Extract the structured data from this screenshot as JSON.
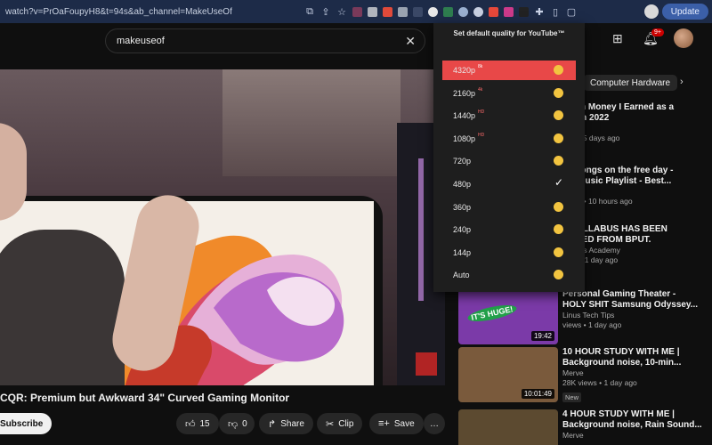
{
  "browser": {
    "url": "watch?v=PrOaFoupyH8&t=94s&ab_channel=MakeUseOf",
    "update_label": "Update"
  },
  "header": {
    "search_value": "makeuseof",
    "notifications_badge": "9+"
  },
  "popup": {
    "title": "Set default quality for YouTube™",
    "options": [
      {
        "label": "4320p",
        "tag": "8k",
        "selected": true
      },
      {
        "label": "2160p",
        "tag": "4k"
      },
      {
        "label": "1440p",
        "tag": "HD"
      },
      {
        "label": "1080p",
        "tag": "HD"
      },
      {
        "label": "720p",
        "tag": ""
      },
      {
        "label": "480p",
        "tag": "",
        "checked": true
      },
      {
        "label": "360p",
        "tag": ""
      },
      {
        "label": "240p",
        "tag": ""
      },
      {
        "label": "144p",
        "tag": ""
      },
      {
        "label": "Auto",
        "tag": ""
      }
    ]
  },
  "video": {
    "title": "CQR: Premium but Awkward 34\" Curved Gaming Monitor",
    "subscribe_label": "Subscribe",
    "like_count": "15",
    "dislike_count": "0",
    "share_label": "Share",
    "clip_label": "Clip",
    "save_label": "Save",
    "more_label": "…"
  },
  "sidebar": {
    "chip_label": "Computer Hardware",
    "recommendations": [
      {
        "title_1": "Much Money I Earned as a",
        "title_2": "ber in 2022",
        "meta_1": "sel",
        "meta_2": "ews • 5 days ago",
        "duration": "",
        "thumb": "#3a2f44"
      },
      {
        "title_1": "ng songs on the free day -",
        "title_2": "&B Music Playlist - Best...",
        "meta_1": "ng ♪",
        "meta_2": "views • 10 hours ago",
        "duration": "",
        "thumb": "#2b2533"
      },
      {
        "title_1": "V SYLLABUS HAS BEEN",
        "title_2": "DUCED FROM BPUT.",
        "meta_1": "sh Sir's Academy",
        "meta_2": "iews • 1 day ago",
        "duration": "",
        "thumb": "#28303a"
      },
      {
        "title_1": "Personal Gaming Theater -",
        "title_2": "HOLY SHIT Samsung Odyssey...",
        "meta_1": "Linus Tech Tips",
        "meta_2": "views • 1 day ago",
        "duration": "19:42",
        "thumb": "#7b3aa8",
        "thumb_text": "IT'S HUGE!"
      },
      {
        "title_1": "10 HOUR STUDY WITH ME |",
        "title_2": "Background noise, 10-min...",
        "meta_1": "Merve",
        "meta_2": "28K views • 1 day ago",
        "duration": "10:01:49",
        "thumb": "#7a5a3c",
        "badge": "New"
      },
      {
        "title_1": "4 HOUR STUDY WITH ME |",
        "title_2": "Background noise, Rain Sound...",
        "meta_1": "Merve",
        "meta_2": "",
        "duration": "",
        "thumb": "#5c4a30"
      }
    ]
  }
}
